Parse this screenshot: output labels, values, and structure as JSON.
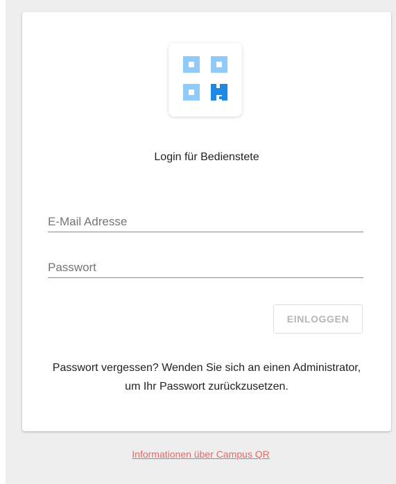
{
  "login_card": {
    "title": "Login für Bedienstete",
    "logo_icon": "campus-qr-logo-icon",
    "email_field": {
      "placeholder": "E-Mail Adresse",
      "value": ""
    },
    "password_field": {
      "placeholder": "Passwort",
      "value": ""
    },
    "login_button_label": "EINLOGGEN",
    "forgot_password_hint": "Passwort vergessen? Wenden Sie sich an einen Administrator, um Ihr Passwort zurückzusetzen."
  },
  "footer": {
    "info_link": "Informationen über Campus QR"
  },
  "colors": {
    "page_background": "#eeeeee",
    "card_background": "#ffffff",
    "logo_light_blue": "#90caf9",
    "logo_dark_blue": "#1e88e5",
    "link_color": "#ef6464",
    "button_text_disabled": "#b5b5b5"
  }
}
